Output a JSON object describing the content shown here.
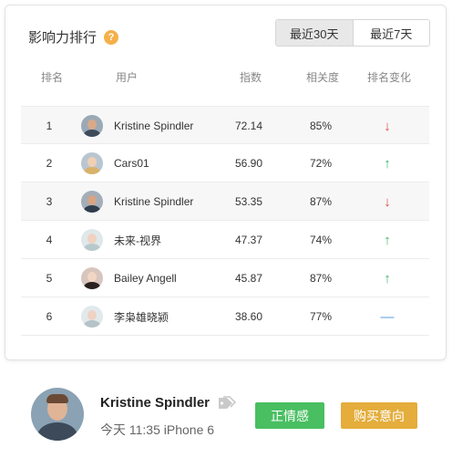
{
  "panel": {
    "title": "影响力排行",
    "help_glyph": "?",
    "ranges": [
      {
        "label": "最近30天",
        "active": true
      },
      {
        "label": "最近7天",
        "active": false
      }
    ]
  },
  "table": {
    "headers": {
      "rank": "排名",
      "user": "用户",
      "index": "指数",
      "relevance": "相关度",
      "change": "排名变化"
    },
    "rows": [
      {
        "rank": "1",
        "user": "Kristine Spindler",
        "index": "72.14",
        "relevance": "85%",
        "change": "↓",
        "trend": "down",
        "avatar": {
          "bg": "#9aa9b5",
          "skin": "#d9a98a",
          "cloth": "#3d4b5a"
        }
      },
      {
        "rank": "2",
        "user": "Cars01",
        "index": "56.90",
        "relevance": "72%",
        "change": "↑",
        "trend": "up",
        "avatar": {
          "bg": "#b9c6d2",
          "skin": "#f0cfb5",
          "cloth": "#d9b26a"
        }
      },
      {
        "rank": "3",
        "user": "Kristine Spindler",
        "index": "53.35",
        "relevance": "87%",
        "change": "↓",
        "trend": "down",
        "avatar": {
          "bg": "#a3aeb8",
          "skin": "#d8a486",
          "cloth": "#2f3d4d"
        }
      },
      {
        "rank": "4",
        "user": "未来-视界",
        "index": "47.37",
        "relevance": "74%",
        "change": "↑",
        "trend": "up",
        "avatar": {
          "bg": "#dfe8ea",
          "skin": "#efd2c0",
          "cloth": "#b8c9cc"
        }
      },
      {
        "rank": "5",
        "user": "Bailey Angell",
        "index": "45.87",
        "relevance": "87%",
        "change": "↑",
        "trend": "up",
        "avatar": {
          "bg": "#d8c6be",
          "skin": "#f2d6c4",
          "cloth": "#2a2020"
        }
      },
      {
        "rank": "6",
        "user": "李枭雄晓颍",
        "index": "38.60",
        "relevance": "77%",
        "change": "—",
        "trend": "flat",
        "avatar": {
          "bg": "#e2e9ec",
          "skin": "#eed3c3",
          "cloth": "#b3c3c8"
        }
      }
    ]
  },
  "profile": {
    "name": "Kristine Spindler",
    "meta": "今天 11:35 iPhone 6",
    "tag_icon": "tag-icon",
    "positive_label": "正情感",
    "purchase_label": "购买意向",
    "colors": {
      "positive": "#49bf61",
      "purchase": "#e4ad3c"
    }
  }
}
